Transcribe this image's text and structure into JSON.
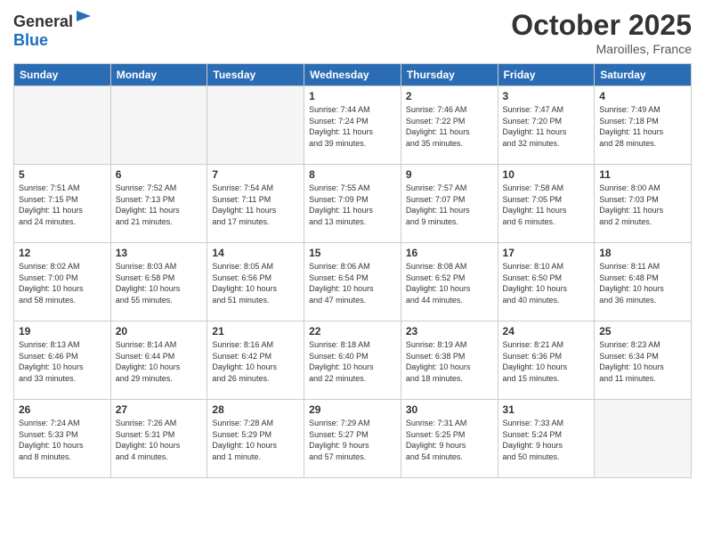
{
  "header": {
    "logo_general": "General",
    "logo_blue": "Blue",
    "month": "October 2025",
    "location": "Maroilles, France"
  },
  "weekdays": [
    "Sunday",
    "Monday",
    "Tuesday",
    "Wednesday",
    "Thursday",
    "Friday",
    "Saturday"
  ],
  "weeks": [
    [
      {
        "day": "",
        "info": ""
      },
      {
        "day": "",
        "info": ""
      },
      {
        "day": "",
        "info": ""
      },
      {
        "day": "1",
        "info": "Sunrise: 7:44 AM\nSunset: 7:24 PM\nDaylight: 11 hours\nand 39 minutes."
      },
      {
        "day": "2",
        "info": "Sunrise: 7:46 AM\nSunset: 7:22 PM\nDaylight: 11 hours\nand 35 minutes."
      },
      {
        "day": "3",
        "info": "Sunrise: 7:47 AM\nSunset: 7:20 PM\nDaylight: 11 hours\nand 32 minutes."
      },
      {
        "day": "4",
        "info": "Sunrise: 7:49 AM\nSunset: 7:18 PM\nDaylight: 11 hours\nand 28 minutes."
      }
    ],
    [
      {
        "day": "5",
        "info": "Sunrise: 7:51 AM\nSunset: 7:15 PM\nDaylight: 11 hours\nand 24 minutes."
      },
      {
        "day": "6",
        "info": "Sunrise: 7:52 AM\nSunset: 7:13 PM\nDaylight: 11 hours\nand 21 minutes."
      },
      {
        "day": "7",
        "info": "Sunrise: 7:54 AM\nSunset: 7:11 PM\nDaylight: 11 hours\nand 17 minutes."
      },
      {
        "day": "8",
        "info": "Sunrise: 7:55 AM\nSunset: 7:09 PM\nDaylight: 11 hours\nand 13 minutes."
      },
      {
        "day": "9",
        "info": "Sunrise: 7:57 AM\nSunset: 7:07 PM\nDaylight: 11 hours\nand 9 minutes."
      },
      {
        "day": "10",
        "info": "Sunrise: 7:58 AM\nSunset: 7:05 PM\nDaylight: 11 hours\nand 6 minutes."
      },
      {
        "day": "11",
        "info": "Sunrise: 8:00 AM\nSunset: 7:03 PM\nDaylight: 11 hours\nand 2 minutes."
      }
    ],
    [
      {
        "day": "12",
        "info": "Sunrise: 8:02 AM\nSunset: 7:00 PM\nDaylight: 10 hours\nand 58 minutes."
      },
      {
        "day": "13",
        "info": "Sunrise: 8:03 AM\nSunset: 6:58 PM\nDaylight: 10 hours\nand 55 minutes."
      },
      {
        "day": "14",
        "info": "Sunrise: 8:05 AM\nSunset: 6:56 PM\nDaylight: 10 hours\nand 51 minutes."
      },
      {
        "day": "15",
        "info": "Sunrise: 8:06 AM\nSunset: 6:54 PM\nDaylight: 10 hours\nand 47 minutes."
      },
      {
        "day": "16",
        "info": "Sunrise: 8:08 AM\nSunset: 6:52 PM\nDaylight: 10 hours\nand 44 minutes."
      },
      {
        "day": "17",
        "info": "Sunrise: 8:10 AM\nSunset: 6:50 PM\nDaylight: 10 hours\nand 40 minutes."
      },
      {
        "day": "18",
        "info": "Sunrise: 8:11 AM\nSunset: 6:48 PM\nDaylight: 10 hours\nand 36 minutes."
      }
    ],
    [
      {
        "day": "19",
        "info": "Sunrise: 8:13 AM\nSunset: 6:46 PM\nDaylight: 10 hours\nand 33 minutes."
      },
      {
        "day": "20",
        "info": "Sunrise: 8:14 AM\nSunset: 6:44 PM\nDaylight: 10 hours\nand 29 minutes."
      },
      {
        "day": "21",
        "info": "Sunrise: 8:16 AM\nSunset: 6:42 PM\nDaylight: 10 hours\nand 26 minutes."
      },
      {
        "day": "22",
        "info": "Sunrise: 8:18 AM\nSunset: 6:40 PM\nDaylight: 10 hours\nand 22 minutes."
      },
      {
        "day": "23",
        "info": "Sunrise: 8:19 AM\nSunset: 6:38 PM\nDaylight: 10 hours\nand 18 minutes."
      },
      {
        "day": "24",
        "info": "Sunrise: 8:21 AM\nSunset: 6:36 PM\nDaylight: 10 hours\nand 15 minutes."
      },
      {
        "day": "25",
        "info": "Sunrise: 8:23 AM\nSunset: 6:34 PM\nDaylight: 10 hours\nand 11 minutes."
      }
    ],
    [
      {
        "day": "26",
        "info": "Sunrise: 7:24 AM\nSunset: 5:33 PM\nDaylight: 10 hours\nand 8 minutes."
      },
      {
        "day": "27",
        "info": "Sunrise: 7:26 AM\nSunset: 5:31 PM\nDaylight: 10 hours\nand 4 minutes."
      },
      {
        "day": "28",
        "info": "Sunrise: 7:28 AM\nSunset: 5:29 PM\nDaylight: 10 hours\nand 1 minute."
      },
      {
        "day": "29",
        "info": "Sunrise: 7:29 AM\nSunset: 5:27 PM\nDaylight: 9 hours\nand 57 minutes."
      },
      {
        "day": "30",
        "info": "Sunrise: 7:31 AM\nSunset: 5:25 PM\nDaylight: 9 hours\nand 54 minutes."
      },
      {
        "day": "31",
        "info": "Sunrise: 7:33 AM\nSunset: 5:24 PM\nDaylight: 9 hours\nand 50 minutes."
      },
      {
        "day": "",
        "info": ""
      }
    ]
  ]
}
